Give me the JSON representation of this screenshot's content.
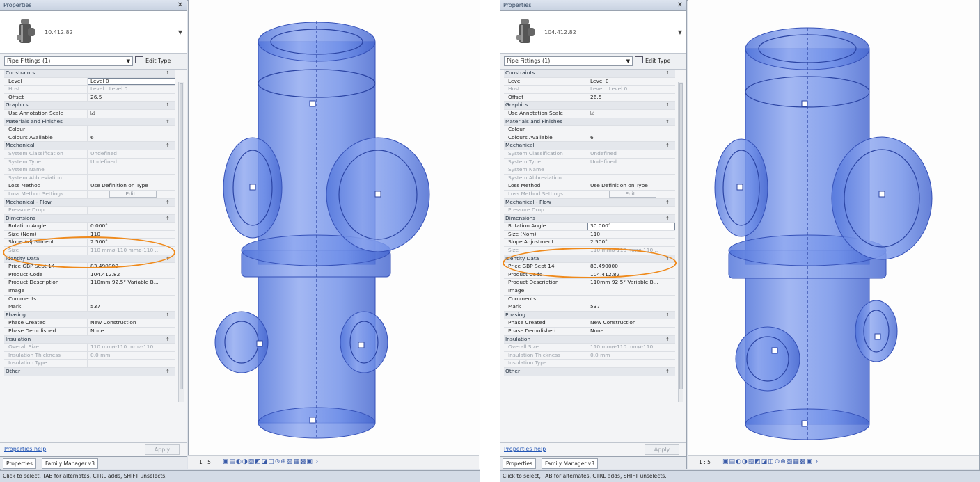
{
  "panes": [
    {
      "title": "Properties",
      "type_name": "10.412.82",
      "selector": "Pipe Fittings (1)",
      "edit_type": "Edit Type",
      "rows": [
        {
          "kind": "group",
          "name": "Constraints",
          "toggle": "⇑"
        },
        {
          "kind": "prop",
          "name": "Level",
          "value": "Level 0",
          "boxed": true
        },
        {
          "kind": "prop",
          "name": "Host",
          "value": "Level : Level 0",
          "ro": true
        },
        {
          "kind": "prop",
          "name": "Offset",
          "value": "26.5"
        },
        {
          "kind": "group",
          "name": "Graphics",
          "toggle": "⇑"
        },
        {
          "kind": "prop",
          "name": "Use Annotation Scale",
          "value": "☑"
        },
        {
          "kind": "group",
          "name": "Materials and Finishes",
          "toggle": "⇑"
        },
        {
          "kind": "prop",
          "name": "Colour",
          "value": ""
        },
        {
          "kind": "prop",
          "name": "Colours Available",
          "value": "6"
        },
        {
          "kind": "group",
          "name": "Mechanical",
          "toggle": "⇑"
        },
        {
          "kind": "prop",
          "name": "System Classification",
          "value": "Undefined",
          "ro": true
        },
        {
          "kind": "prop",
          "name": "System Type",
          "value": "Undefined",
          "ro": true
        },
        {
          "kind": "prop",
          "name": "System Name",
          "value": "",
          "ro": true
        },
        {
          "kind": "prop",
          "name": "System Abbreviation",
          "value": "",
          "ro": true
        },
        {
          "kind": "prop",
          "name": "Loss Method",
          "value": "Use Definition on Type"
        },
        {
          "kind": "prop",
          "name": "Loss Method Settings",
          "value": "Edit...",
          "ro": true,
          "button": true
        },
        {
          "kind": "group",
          "name": "Mechanical - Flow",
          "toggle": "⇑"
        },
        {
          "kind": "prop",
          "name": "Pressure Drop",
          "value": "",
          "ro": true
        },
        {
          "kind": "group",
          "name": "Dimensions",
          "toggle": "⇑"
        },
        {
          "kind": "prop",
          "name": "Rotation Angle",
          "value": "0.000°"
        },
        {
          "kind": "prop",
          "name": "Size (Nom)",
          "value": "110"
        },
        {
          "kind": "prop",
          "name": "Slope Adjustment",
          "value": "2.500°"
        },
        {
          "kind": "prop",
          "name": "Size",
          "value": "110 mmø-110 mmø-110 ...",
          "ro": true
        },
        {
          "kind": "group",
          "name": "Identity Data",
          "toggle": "⇑"
        },
        {
          "kind": "prop",
          "name": "Price GBP Sept 14",
          "value": "83.490000"
        },
        {
          "kind": "prop",
          "name": "Product Code",
          "value": "104.412.82"
        },
        {
          "kind": "prop",
          "name": "Product Description",
          "value": "110mm 92.5° Variable B..."
        },
        {
          "kind": "prop",
          "name": "Image",
          "value": ""
        },
        {
          "kind": "prop",
          "name": "Comments",
          "value": ""
        },
        {
          "kind": "prop",
          "name": "Mark",
          "value": "537"
        },
        {
          "kind": "group",
          "name": "Phasing",
          "toggle": "⇑"
        },
        {
          "kind": "prop",
          "name": "Phase Created",
          "value": "New Construction"
        },
        {
          "kind": "prop",
          "name": "Phase Demolished",
          "value": "None"
        },
        {
          "kind": "group",
          "name": "Insulation",
          "toggle": "⇑"
        },
        {
          "kind": "prop",
          "name": "Overall Size",
          "value": "110 mmø-110 mmø-110 ...",
          "ro": true
        },
        {
          "kind": "prop",
          "name": "Insulation Thickness",
          "value": "0.0 mm",
          "ro": true
        },
        {
          "kind": "prop",
          "name": "Insulation Type",
          "value": "",
          "ro": true
        },
        {
          "kind": "group",
          "name": "Other",
          "toggle": "⇑"
        }
      ],
      "help_link": "Properties help",
      "apply": "Apply",
      "tabs": [
        "Properties",
        "Family Manager v3"
      ],
      "scale": "1 : 5",
      "status": "Click to select, TAB for alternates, CTRL adds, SHIFT unselects."
    },
    {
      "title": "Properties",
      "type_name": "104.412.82",
      "selector": "Pipe Fittings (1)",
      "edit_type": "Edit Type",
      "rows": [
        {
          "kind": "group",
          "name": "Constraints",
          "toggle": "⇑"
        },
        {
          "kind": "prop",
          "name": "Level",
          "value": "Level 0"
        },
        {
          "kind": "prop",
          "name": "Host",
          "value": "Level : Level 0",
          "ro": true
        },
        {
          "kind": "prop",
          "name": "Offset",
          "value": "26.5"
        },
        {
          "kind": "group",
          "name": "Graphics",
          "toggle": "⇑"
        },
        {
          "kind": "prop",
          "name": "Use Annotation Scale",
          "value": "☑"
        },
        {
          "kind": "group",
          "name": "Materials and Finishes",
          "toggle": "⇑"
        },
        {
          "kind": "prop",
          "name": "Colour",
          "value": ""
        },
        {
          "kind": "prop",
          "name": "Colours Available",
          "value": "6"
        },
        {
          "kind": "group",
          "name": "Mechanical",
          "toggle": "⇑"
        },
        {
          "kind": "prop",
          "name": "System Classification",
          "value": "Undefined",
          "ro": true
        },
        {
          "kind": "prop",
          "name": "System Type",
          "value": "Undefined",
          "ro": true
        },
        {
          "kind": "prop",
          "name": "System Name",
          "value": "",
          "ro": true
        },
        {
          "kind": "prop",
          "name": "System Abbreviation",
          "value": "",
          "ro": true
        },
        {
          "kind": "prop",
          "name": "Loss Method",
          "value": "Use Definition on Type"
        },
        {
          "kind": "prop",
          "name": "Loss Method Settings",
          "value": "Edit...",
          "ro": true,
          "button": true
        },
        {
          "kind": "group",
          "name": "Mechanical - Flow",
          "toggle": "⇑"
        },
        {
          "kind": "prop",
          "name": "Pressure Drop",
          "value": "",
          "ro": true
        },
        {
          "kind": "group",
          "name": "Dimensions",
          "toggle": "⇑"
        },
        {
          "kind": "prop",
          "name": "Rotation Angle",
          "value": "30.000°",
          "boxed": true
        },
        {
          "kind": "prop",
          "name": "Size (Nom)",
          "value": "110"
        },
        {
          "kind": "prop",
          "name": "Slope Adjustment",
          "value": "2.500°"
        },
        {
          "kind": "prop",
          "name": "Size",
          "value": "110 mmø-110 mmø-110...",
          "ro": true
        },
        {
          "kind": "group",
          "name": "Identity Data",
          "toggle": "⇑"
        },
        {
          "kind": "prop",
          "name": "Price GBP Sept 14",
          "value": "83.490000"
        },
        {
          "kind": "prop",
          "name": "Product Code",
          "value": "104.412.82"
        },
        {
          "kind": "prop",
          "name": "Product Description",
          "value": "110mm 92.5° Variable B..."
        },
        {
          "kind": "prop",
          "name": "Image",
          "value": ""
        },
        {
          "kind": "prop",
          "name": "Comments",
          "value": ""
        },
        {
          "kind": "prop",
          "name": "Mark",
          "value": "537"
        },
        {
          "kind": "group",
          "name": "Phasing",
          "toggle": "⇑"
        },
        {
          "kind": "prop",
          "name": "Phase Created",
          "value": "New Construction"
        },
        {
          "kind": "prop",
          "name": "Phase Demolished",
          "value": "None"
        },
        {
          "kind": "group",
          "name": "Insulation",
          "toggle": "⇑"
        },
        {
          "kind": "prop",
          "name": "Overall Size",
          "value": "110 mmø-110 mmø-110...",
          "ro": true
        },
        {
          "kind": "prop",
          "name": "Insulation Thickness",
          "value": "0.0 mm",
          "ro": true
        },
        {
          "kind": "prop",
          "name": "Insulation Type",
          "value": "",
          "ro": true
        },
        {
          "kind": "group",
          "name": "Other",
          "toggle": "⇑"
        }
      ],
      "help_link": "Properties help",
      "apply": "Apply",
      "tabs": [
        "Properties",
        "Family Manager v3"
      ],
      "scale": "1 : 5",
      "status": "Click to select, TAB for alternates, CTRL adds, SHIFT unselects."
    }
  ],
  "colors": {
    "highlight_oval": "#ef8a1c",
    "selection_blue": "#5d7fe0",
    "link": "#2456b5"
  },
  "icons": {
    "close": "close-icon",
    "type_thumbnail": "pipe-fitting-thumbnail-icon",
    "view_controls": "view-control-icons"
  }
}
